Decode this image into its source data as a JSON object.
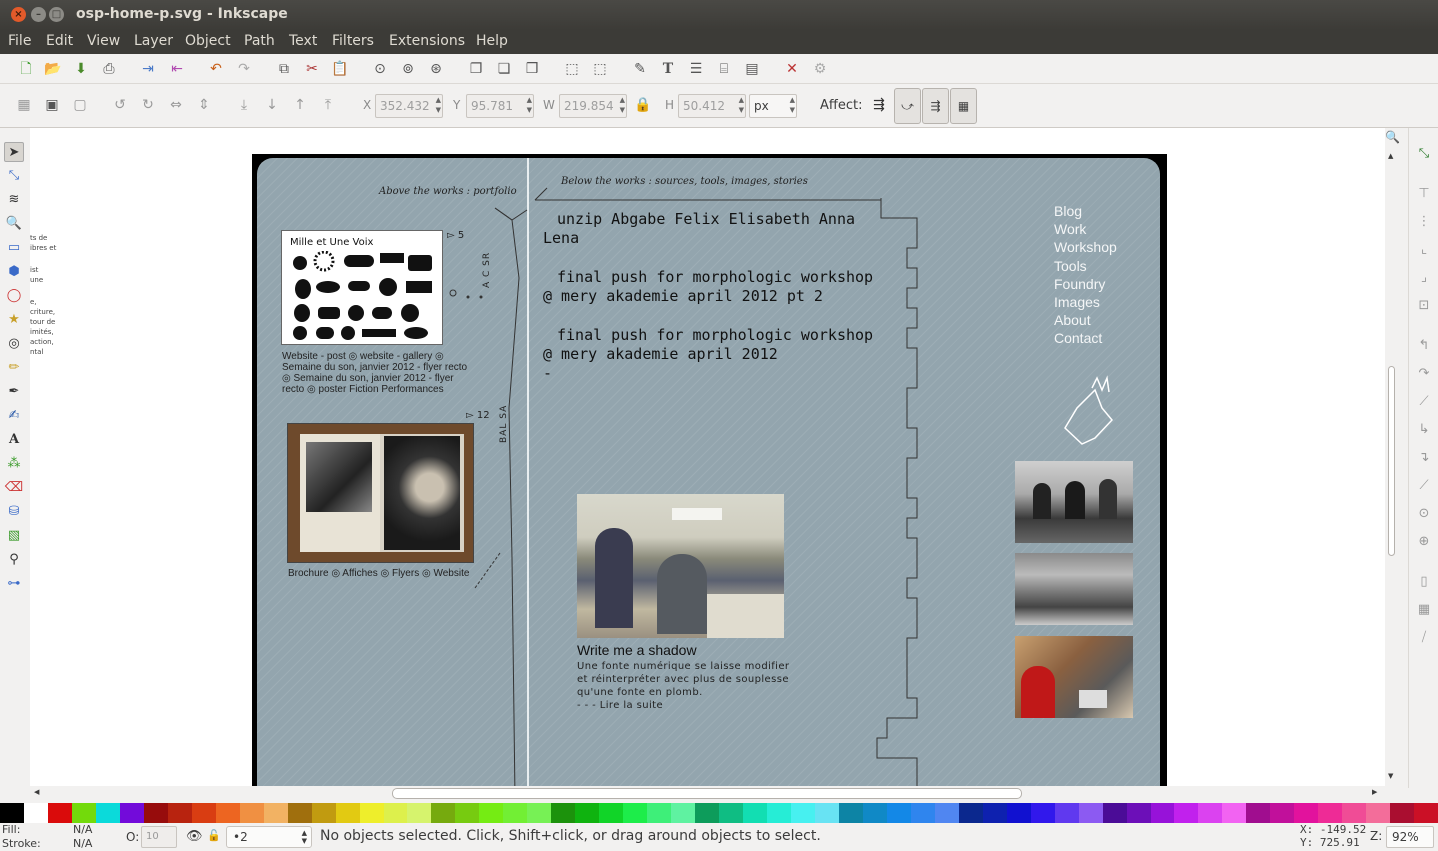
{
  "window": {
    "title": "osp-home-p.svg - Inkscape"
  },
  "menu": [
    "File",
    "Edit",
    "View",
    "Layer",
    "Object",
    "Path",
    "Text",
    "Filters",
    "Extensions",
    "Help"
  ],
  "controls": {
    "x_label": "X",
    "x_value": "352.432",
    "y_label": "Y",
    "y_value": "95.781",
    "w_label": "W",
    "w_value": "219.854",
    "h_label": "H",
    "h_value": "50.412",
    "unit": "px",
    "affect_label": "Affect:"
  },
  "doc": {
    "left_caption": "Above the works : portfolio",
    "right_caption": "Below the works : sources, tools, images, stories",
    "card1": {
      "title": "Mille et Une Voix",
      "count": "▻ 5",
      "caption": [
        "Website - post ◎ website - gallery ◎",
        "Semaine du son, janvier 2012 - flyer recto",
        "◎ Semaine du son, janvier 2012 - flyer",
        "recto ◎ poster Fiction Performances"
      ]
    },
    "card2": {
      "count": "▻ 12",
      "caption": "Brochure ◎ Affiches ◎ Flyers ◎ Website"
    },
    "vertical1": "A C SR",
    "vertical2": "BAL SA",
    "posts": [
      {
        "line1": "unzip Abgabe Felix Elisabeth Anna",
        "line2": "Lena"
      },
      {
        "line1": "final push for morphologic workshop",
        "line2": "@ mery akademie april 2012 pt 2"
      },
      {
        "line1": "final push for morphologic workshop",
        "line2": "@ mery akademie april 2012"
      }
    ],
    "dash": "-",
    "shadow": {
      "title": "Write me a shadow",
      "body": [
        "Une fonte numérique se laisse modifier",
        "et réinterpréter avec plus de souplesse",
        "qu'une fonte en plomb.",
        "- - - Lire la suite"
      ]
    },
    "nav": [
      "Blog",
      "Work",
      "Workshop",
      "Tools",
      "Foundry",
      "Images",
      "About",
      "Contact"
    ],
    "stub": [
      "ts de",
      "ibres et",
      "",
      "ist",
      "une",
      "",
      "e,",
      "criture,",
      "tour de",
      "imités,",
      "action,",
      "ntal"
    ]
  },
  "status": {
    "fill_label": "Fill:",
    "fill_value": "N/A",
    "stroke_label": "Stroke:",
    "stroke_value": "N/A",
    "opacity_label": "O:",
    "opacity_value": "10",
    "layer": "•2",
    "message": "No objects selected. Click, Shift+click, or drag around objects to select.",
    "x_coord": "X: -149.52",
    "y_coord": "Y:  725.91",
    "zoom_label": "Z:",
    "zoom_value": "92%"
  }
}
